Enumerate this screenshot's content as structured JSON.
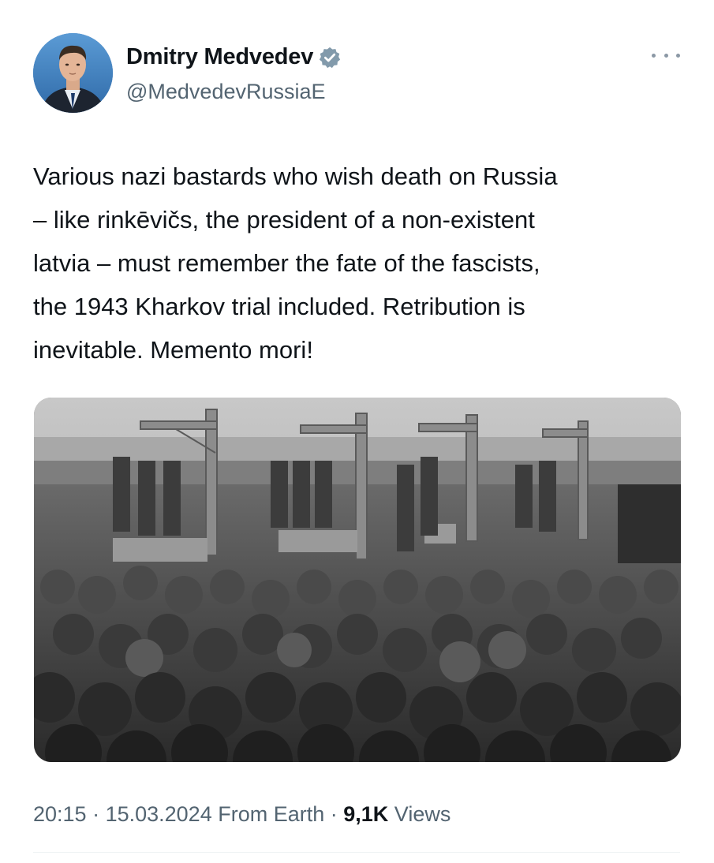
{
  "author": {
    "display_name": "Dmitry Medvedev",
    "handle": "@MedvedevRussiaE",
    "verified": true,
    "avatar_icon": "profile-photo"
  },
  "tweet": {
    "text": "Various nazi bastards who wish death on Russia\n– like rinkēvičs, the president of a non-existent\nlatvia – must remember the fate of the fascists,\nthe 1943 Kharkov trial included. Retribution is\ninevitable. Memento mori!",
    "media": {
      "type": "photo",
      "tone": "black-and-white"
    }
  },
  "meta": {
    "time": "20:15",
    "separator1": " · ",
    "date": "15.03.2024",
    "source": " From Earth",
    "separator2": " · ",
    "views_count": "9,1K",
    "views_label": " Views"
  },
  "icons": {
    "verified": "verified-badge-icon",
    "more": "more-options-icon"
  },
  "colors": {
    "text_primary": "#0f1419",
    "text_secondary": "#536471",
    "verified_badge": "#829aab",
    "divider": "#eff3f4"
  }
}
